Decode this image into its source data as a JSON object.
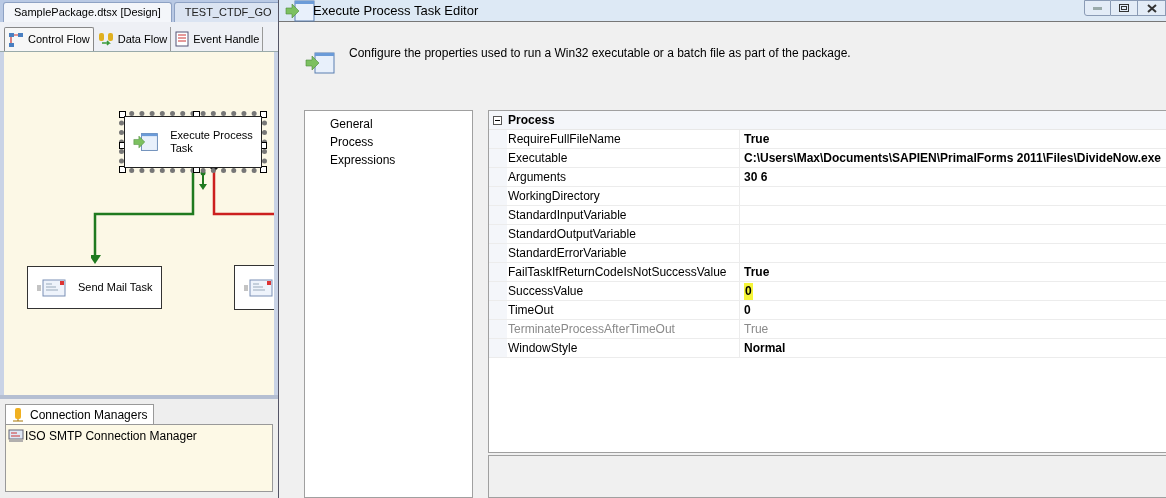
{
  "ide": {
    "document_tabs": [
      {
        "label": "SamplePackage.dtsx [Design]",
        "selected": true
      },
      {
        "label": "TEST_CTDF_GO",
        "selected": false
      }
    ],
    "designer_tabs": [
      {
        "label": "Control Flow",
        "kind": "flow",
        "selected": true
      },
      {
        "label": "Data Flow",
        "kind": "data",
        "selected": false
      },
      {
        "label": "Event Handle",
        "kind": "events",
        "selected": false
      }
    ],
    "tasks": [
      {
        "label": "Execute Process Task",
        "kind": "process",
        "selected": true
      },
      {
        "label": "Send Mail Task",
        "kind": "mail",
        "selected": false
      },
      {
        "kind": "mail",
        "selected": false
      }
    ],
    "connection_managers": {
      "tab": "Connection Managers",
      "items": [
        "ISO SMTP Connection Manager"
      ]
    }
  },
  "dialog": {
    "title": "Execute Process Task Editor",
    "description": "Configure the properties used to run a Win32 executable or a batch file as part of the package.",
    "nav_items": [
      "General",
      "Process",
      "Expressions"
    ],
    "property_grid": {
      "category": "Process",
      "expanded": true,
      "rows": [
        {
          "name": "RequireFullFileName",
          "value": "True",
          "bold": true,
          "disabled": false,
          "highlighted": false
        },
        {
          "name": "Executable",
          "value": "C:\\Users\\Max\\Documents\\SAPIEN\\PrimalForms 2011\\Files\\DivideNow.exe",
          "bold": true,
          "disabled": false,
          "highlighted": false
        },
        {
          "name": "Arguments",
          "value": "30 6",
          "bold": true,
          "disabled": false,
          "highlighted": false
        },
        {
          "name": "WorkingDirectory",
          "disabled": false
        },
        {
          "name": "StandardInputVariable",
          "disabled": false
        },
        {
          "name": "StandardOutputVariable",
          "disabled": false
        },
        {
          "name": "StandardErrorVariable",
          "disabled": false
        },
        {
          "name": "FailTaskIfReturnCodeIsNotSuccessValue",
          "value": "True",
          "bold": true,
          "disabled": false,
          "highlighted": false
        },
        {
          "name": "SuccessValue",
          "value": "0",
          "bold": true,
          "disabled": false,
          "highlighted": true
        },
        {
          "name": "TimeOut",
          "value": "0",
          "bold": true,
          "disabled": false,
          "highlighted": false
        },
        {
          "name": "TerminateProcessAfterTimeOut",
          "value": "True",
          "bold": false,
          "disabled": true,
          "highlighted": false
        },
        {
          "name": "WindowStyle",
          "value": "Normal",
          "bold": true,
          "disabled": false,
          "highlighted": false
        }
      ]
    }
  }
}
